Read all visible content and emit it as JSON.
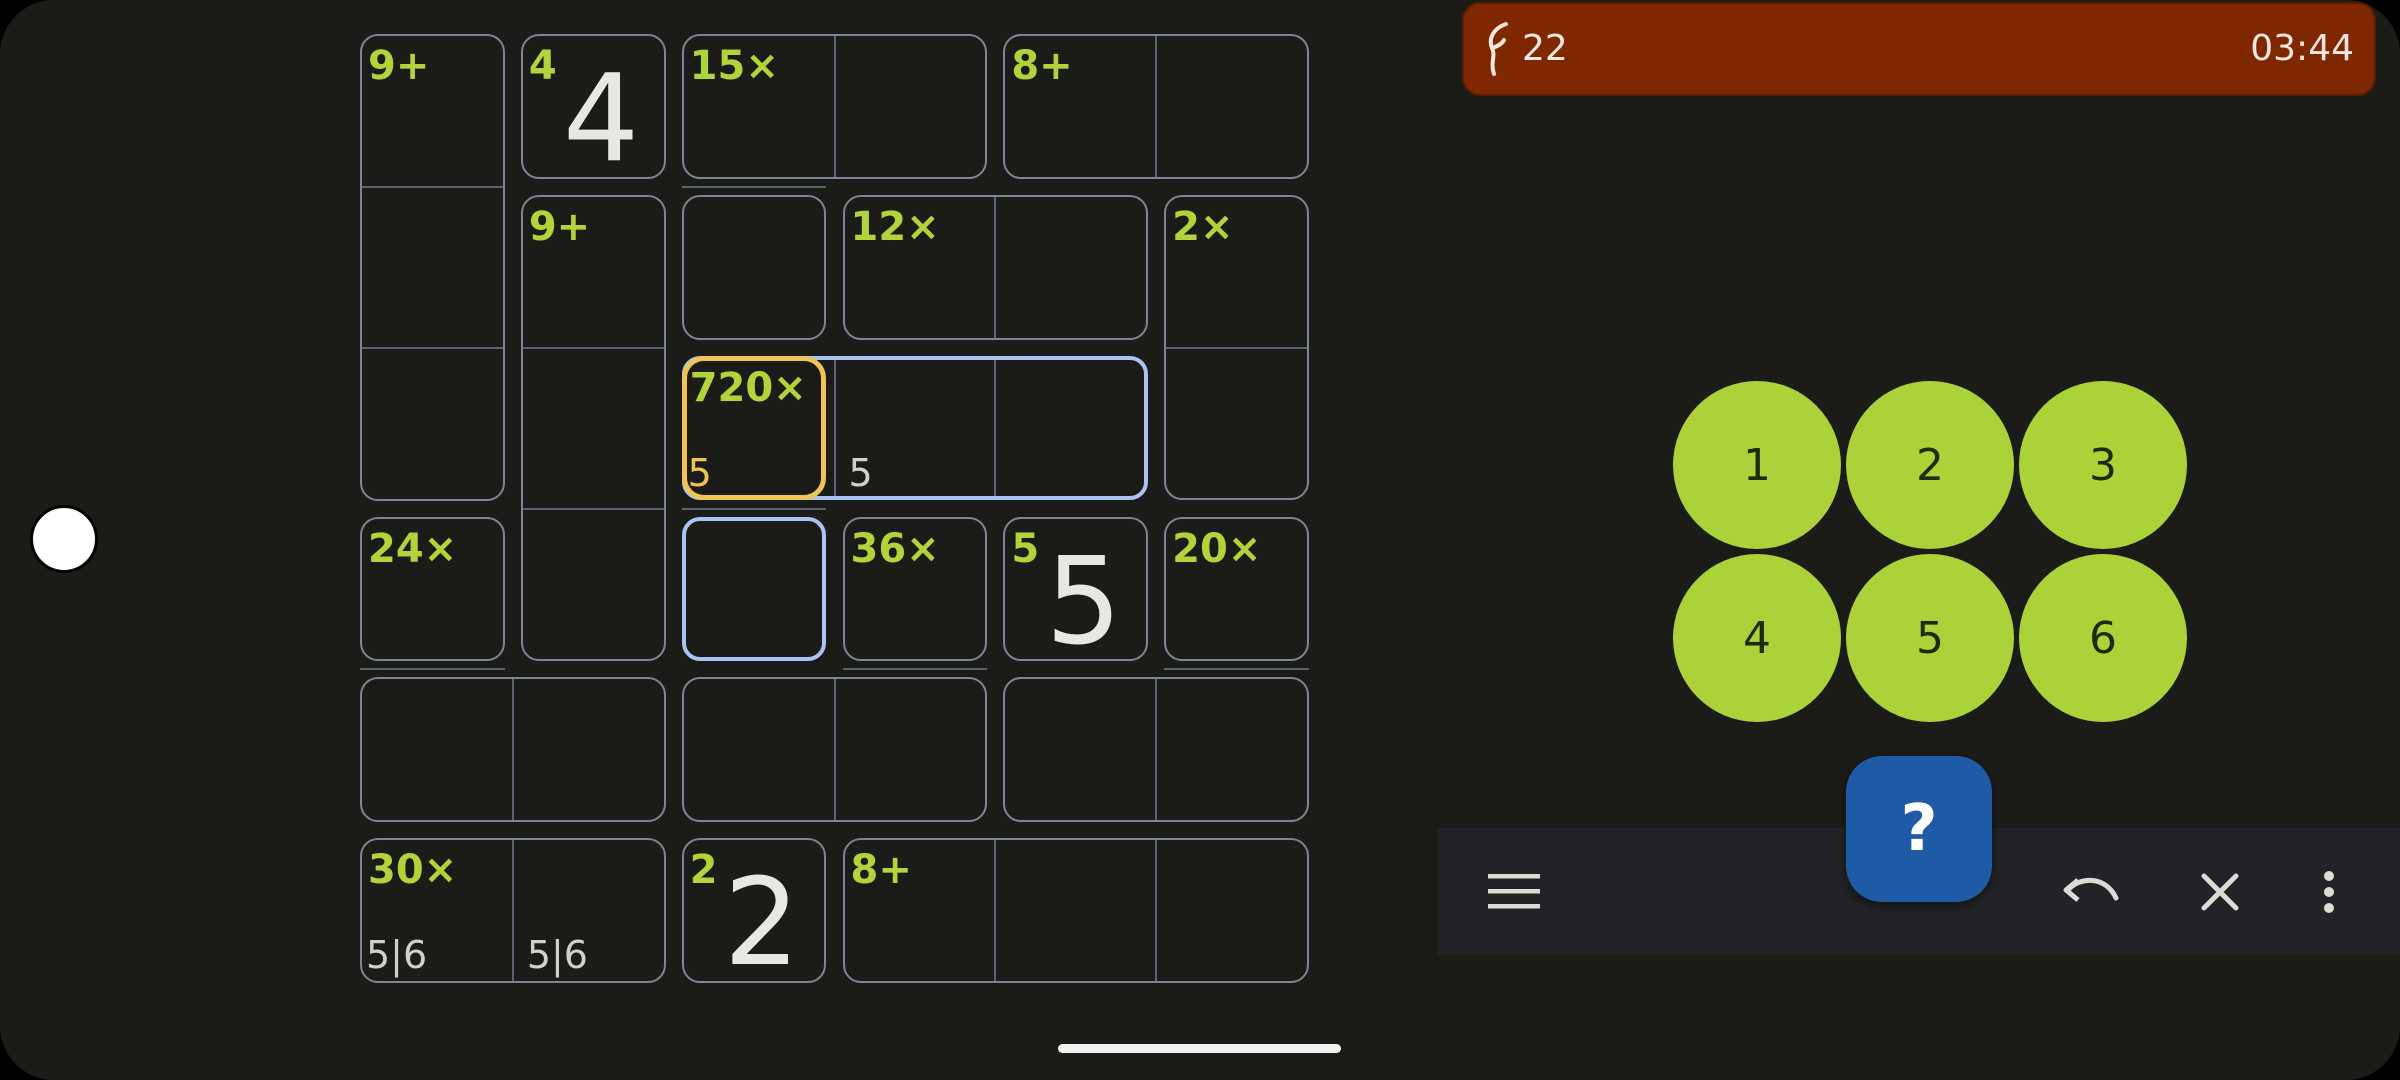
{
  "status": {
    "count": "22",
    "timer": "03:44",
    "background": "#7f2700",
    "icon": "squiggle-icon"
  },
  "puzzle": {
    "size": 6,
    "cages": [
      {
        "clue": "9+",
        "cells": [
          [
            0,
            0
          ],
          [
            1,
            0
          ],
          [
            2,
            0
          ]
        ]
      },
      {
        "clue": "4",
        "cells": [
          [
            0,
            1
          ]
        ]
      },
      {
        "clue": "15×",
        "cells": [
          [
            0,
            2
          ],
          [
            0,
            3
          ],
          [
            1,
            2
          ]
        ]
      },
      {
        "clue": "8+",
        "cells": [
          [
            0,
            4
          ],
          [
            0,
            5
          ]
        ]
      },
      {
        "clue": "9+",
        "cells": [
          [
            1,
            1
          ],
          [
            2,
            1
          ],
          [
            3,
            1
          ]
        ]
      },
      {
        "clue": "12×",
        "cells": [
          [
            1,
            3
          ],
          [
            1,
            4
          ]
        ]
      },
      {
        "clue": "2×",
        "cells": [
          [
            1,
            5
          ],
          [
            2,
            5
          ]
        ]
      },
      {
        "clue": "720×",
        "cells": [
          [
            2,
            2
          ],
          [
            2,
            3
          ],
          [
            2,
            4
          ],
          [
            3,
            2
          ]
        ]
      },
      {
        "clue": "24×",
        "cells": [
          [
            3,
            0
          ],
          [
            4,
            0
          ],
          [
            4,
            1
          ]
        ]
      },
      {
        "clue": "36×",
        "cells": [
          [
            3,
            3
          ],
          [
            4,
            3
          ],
          [
            4,
            2
          ]
        ]
      },
      {
        "clue": "5",
        "cells": [
          [
            3,
            4
          ]
        ]
      },
      {
        "clue": "20×",
        "cells": [
          [
            3,
            5
          ],
          [
            4,
            5
          ],
          [
            4,
            4
          ]
        ]
      },
      {
        "clue": "30×",
        "cells": [
          [
            5,
            0
          ],
          [
            5,
            1
          ]
        ]
      },
      {
        "clue": "2",
        "cells": [
          [
            5,
            2
          ]
        ]
      },
      {
        "clue": "8+",
        "cells": [
          [
            5,
            3
          ],
          [
            5,
            4
          ],
          [
            5,
            5
          ]
        ]
      }
    ],
    "values": [
      {
        "r": 0,
        "c": 1,
        "v": "4"
      },
      {
        "r": 3,
        "c": 4,
        "v": "5"
      },
      {
        "r": 5,
        "c": 2,
        "v": "2"
      }
    ],
    "notes": [
      {
        "r": 2,
        "c": 2,
        "text": "5",
        "highlight": true
      },
      {
        "r": 2,
        "c": 3,
        "text": "5",
        "highlight": false
      },
      {
        "r": 5,
        "c": 0,
        "text": "5|6",
        "highlight": false
      },
      {
        "r": 5,
        "c": 1,
        "text": "5|6",
        "highlight": false
      }
    ],
    "selected_cell": {
      "r": 2,
      "c": 2
    },
    "selected_cage": 7
  },
  "keypad": {
    "digits": [
      "1",
      "2",
      "3",
      "4",
      "5",
      "6"
    ],
    "color": "#acd23a"
  },
  "help_button": {
    "label": "?",
    "color": "#1f5aa6"
  },
  "toolbar": {
    "menu": "menu-icon",
    "undo": "undo-icon",
    "clear": "close-icon",
    "more": "more-vert-icon"
  }
}
